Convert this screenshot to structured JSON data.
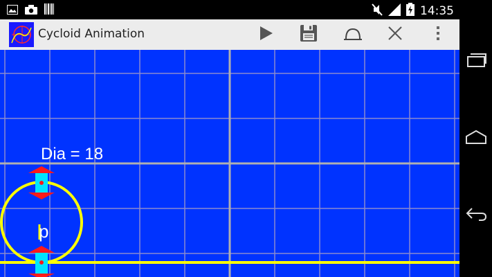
{
  "status_bar": {
    "time": "14:35",
    "icons": [
      "image-icon",
      "camera-icon",
      "barcode-icon",
      "mute-icon",
      "signal-icon",
      "battery-charging-icon"
    ]
  },
  "action_bar": {
    "title": "Cycloid Animation",
    "actions": [
      "play-icon",
      "save-icon",
      "cycloid-icon",
      "close-icon",
      "overflow-menu-icon"
    ]
  },
  "canvas": {
    "diameter_label": "Dia = 18",
    "point_label": "p",
    "colors": {
      "background": "#0033ff",
      "grid": "#8a8acf",
      "axis": "#b0b0b0",
      "circle": "#ffff00",
      "ground_line": "#ffff00",
      "marker": "#00e5ff",
      "arrow": "#ff1a1a"
    }
  },
  "nav_bar": {
    "buttons": [
      "recent-apps-icon",
      "home-icon",
      "back-icon"
    ]
  }
}
